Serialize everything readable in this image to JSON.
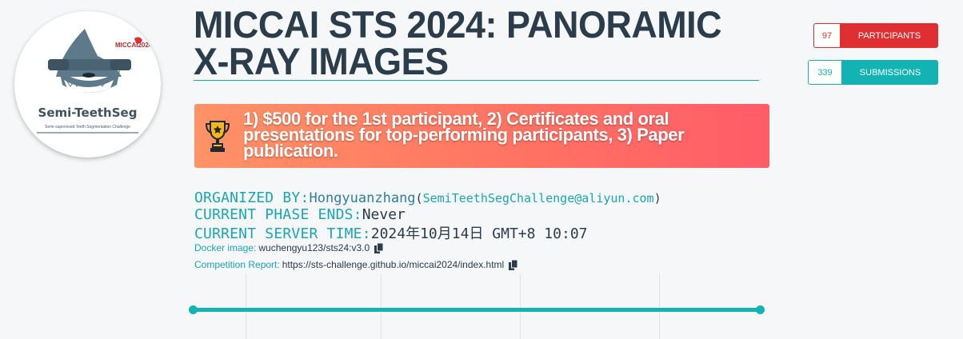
{
  "logo": {
    "title": "Semi-TeethSeg",
    "subtitle": "Semi-supervised Teeth Segmentation Challenge",
    "brand": "MICCAI2024"
  },
  "competition": {
    "title_line1": "MICCAI STS 2024: PANORAMIC",
    "title_line2": "X-RAY IMAGES"
  },
  "stats": {
    "participants_count": "97",
    "participants_label": "PARTICIPANTS",
    "submissions_count": "339",
    "submissions_label": "SUBMISSIONS"
  },
  "prize": {
    "icon": "trophy-icon",
    "text": "1) $500 for the 1st participant, 2) Certificates and oral presentations for top-performing participants, 3) Paper publication."
  },
  "info": {
    "organized_by_label": "ORGANIZED BY:",
    "organizer": "Hongyuanzhang",
    "paren_open": "(",
    "organizer_email": "SemiTeethSegChallenge@aliyun.com",
    "paren_close": ")",
    "phase_ends_label": "CURRENT PHASE ENDS:",
    "phase_ends_value": "Never",
    "server_time_label": "CURRENT SERVER TIME:",
    "server_time_value": "2024年10月14日 GMT+8 10:07",
    "docker_label": "Docker image:",
    "docker_value": "wuchengyu123/sts24:v3.0",
    "report_label": "Competition Report:",
    "report_value": "https://sts-challenge.github.io/miccai2024/index.html"
  },
  "colors": {
    "accent": "#14b3b3",
    "participants": "#e02f33",
    "title": "#2b3c4b"
  }
}
